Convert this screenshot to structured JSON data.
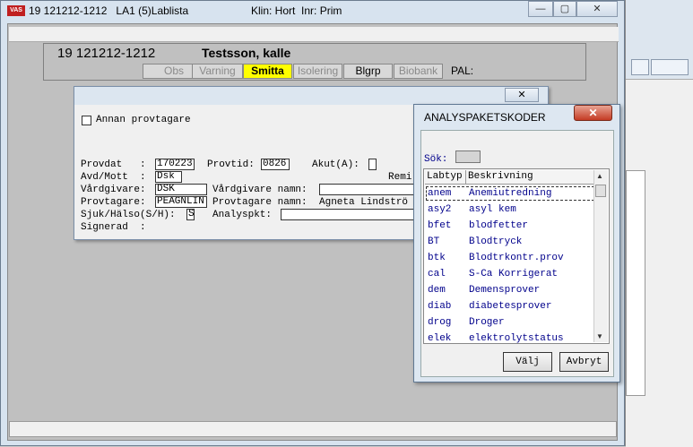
{
  "main_window": {
    "icon_text": "VAS",
    "title": "19 121212-1212   LA1 (5)Lablista",
    "klin": "Klin: Hort  Inr: Prim",
    "minimize": "—",
    "maximize": "▢",
    "close": "✕"
  },
  "patient": {
    "id": "19 121212-1212",
    "name": "Testsson, kalle",
    "tabs": [
      "Obs",
      "Varning",
      "Smitta",
      "Isolering",
      "Blgrp",
      "Biobank"
    ],
    "pal": "PAL:"
  },
  "sample_dialog": {
    "close": "✕",
    "annan_provtagare": "Annan provtagare",
    "provdat_label": "Provdat   :",
    "provdat_value": "170223",
    "provtid_label": "Provtid:",
    "provtid_value": "0826",
    "akut_label": "Akut(A):",
    "avd_label": "Avd/Mott  :",
    "avd_value": "Dsk",
    "remi_label": "Remi",
    "vardgivare_label": "Vårdgivare:",
    "vardgivare_value": "DSK",
    "vardgivare_namn_label": "Vårdgivare namn:",
    "provtagare_label": "Provtagare:",
    "provtagare_value": "PEAGNLIN",
    "provtagare_namn_label": "Provtagare namn:",
    "provtagare_namn_value": "Agneta Lindströ",
    "sjuk_label": "Sjuk/Hälso(S/H):",
    "sjuk_value": "S",
    "analyspkt_label": "Analyspkt:",
    "signerad_label": "Signerad  :"
  },
  "analys_window": {
    "title": "ANALYSPAKETSKODER",
    "close": "✕",
    "sok_label": "Sök:",
    "col_labtyp": "Labtyp",
    "col_beskrivning": "Beskrivning",
    "rows": [
      {
        "code": "anem",
        "desc": "Anemiutredning"
      },
      {
        "code": "asy2",
        "desc": "asyl kem"
      },
      {
        "code": "bfet",
        "desc": "blodfetter"
      },
      {
        "code": "BT",
        "desc": "Blodtryck"
      },
      {
        "code": "btk",
        "desc": "Blodtrkontr.prov"
      },
      {
        "code": "cal",
        "desc": "S-Ca Korrigerat"
      },
      {
        "code": "dem",
        "desc": "Demensprover"
      },
      {
        "code": "diab",
        "desc": "diabetesprover"
      },
      {
        "code": "drog",
        "desc": "Droger"
      },
      {
        "code": "elek",
        "desc": "elektrolytstatus"
      }
    ],
    "valj": "Välj",
    "avbryt": "Avbryt"
  }
}
